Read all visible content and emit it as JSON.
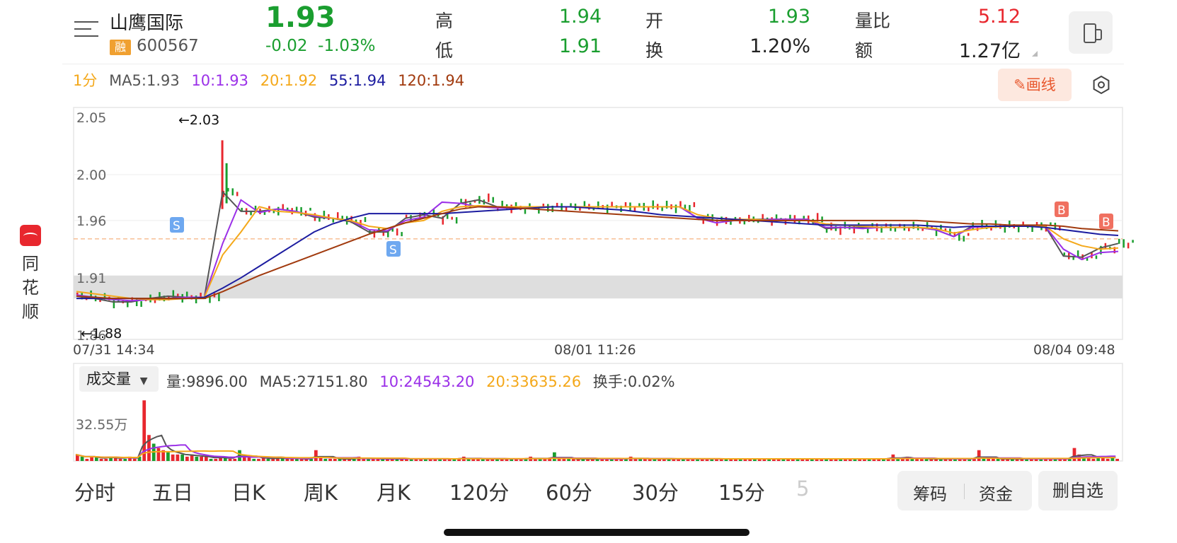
{
  "brand": {
    "name_chars": [
      "同",
      "花",
      "顺"
    ]
  },
  "header": {
    "stock_name": "山鹰国际",
    "rong_badge": "融",
    "stock_code": "600567",
    "price": "1.93",
    "change": "-0.02",
    "change_pct": "-1.03%",
    "quotes": [
      {
        "label": "高",
        "value": "1.94",
        "color": "#1a9e2f"
      },
      {
        "label": "低",
        "value": "1.91",
        "color": "#1a9e2f"
      },
      {
        "label": "开",
        "value": "1.93",
        "color": "#1a9e2f"
      },
      {
        "label": "换",
        "value": "1.20%",
        "color": "#222222"
      },
      {
        "label": "量比",
        "value": "5.12",
        "color": "#e8272e"
      },
      {
        "label": "额",
        "value": "1.27亿",
        "color": "#222222"
      }
    ]
  },
  "ma_legend": {
    "period": "1分",
    "ma5": "MA5:1.93",
    "ma10": "10:1.93",
    "ma20": "20:1.92",
    "ma55": "55:1.94",
    "ma120": "120:1.94"
  },
  "draw_button": {
    "label": "画线"
  },
  "colors": {
    "up": "#e8272e",
    "down": "#1a9e2f",
    "ma5": "#555555",
    "ma10": "#9b30e8",
    "ma20": "#f4a81a",
    "ma55": "#1c1ca0",
    "ma120": "#a13a0e"
  },
  "chart_data": {
    "type": "line",
    "title": "",
    "y_ticks": [
      "2.05",
      "2.00",
      "1.96",
      "1.91",
      "1.86"
    ],
    "ylim": [
      1.86,
      2.05
    ],
    "x_labels": [
      "07/31 14:34",
      "08/01 11:26",
      "08/04 09:48"
    ],
    "annotations": {
      "high": "←2.03",
      "low": "←1.88",
      "signals": [
        "S",
        "S",
        "B",
        "B"
      ]
    },
    "series": [
      {
        "name": "MA5",
        "color": "#555555",
        "values": [
          1.894,
          1.892,
          1.889,
          1.889,
          1.892,
          1.894,
          1.893,
          1.893,
          1.985,
          1.968,
          1.968,
          1.97,
          1.968,
          1.963,
          1.962,
          1.959,
          1.95,
          1.95,
          1.962,
          1.965,
          1.962,
          1.975,
          1.978,
          1.972,
          1.971,
          1.971,
          1.972,
          1.972,
          1.972,
          1.972,
          1.972,
          1.972,
          1.972,
          1.972,
          1.962,
          1.96,
          1.96,
          1.961,
          1.961,
          1.961,
          1.961,
          1.953,
          1.954,
          1.954,
          1.954,
          1.954,
          1.954,
          1.952,
          1.946,
          1.955,
          1.955,
          1.955,
          1.955,
          1.955,
          1.929,
          1.928,
          1.936,
          1.94
        ]
      },
      {
        "name": "10",
        "color": "#9b30e8",
        "values": [
          1.895,
          1.893,
          1.891,
          1.89,
          1.891,
          1.892,
          1.893,
          1.893,
          1.94,
          1.978,
          1.967,
          1.97,
          1.968,
          1.964,
          1.962,
          1.96,
          1.952,
          1.951,
          1.96,
          1.963,
          1.976,
          1.975,
          1.972,
          1.971,
          1.971,
          1.972,
          1.972,
          1.972,
          1.972,
          1.972,
          1.972,
          1.972,
          1.972,
          1.972,
          1.962,
          1.958,
          1.96,
          1.96,
          1.961,
          1.961,
          1.961,
          1.954,
          1.954,
          1.953,
          1.954,
          1.954,
          1.954,
          1.952,
          1.946,
          1.954,
          1.955,
          1.955,
          1.955,
          1.955,
          1.935,
          1.926,
          1.932,
          1.933
        ]
      },
      {
        "name": "20",
        "color": "#f4a81a",
        "values": [
          1.898,
          1.896,
          1.894,
          1.892,
          1.891,
          1.891,
          1.892,
          1.893,
          1.93,
          1.95,
          1.972,
          1.968,
          1.967,
          1.965,
          1.962,
          1.96,
          1.955,
          1.953,
          1.958,
          1.96,
          1.968,
          1.972,
          1.973,
          1.972,
          1.972,
          1.972,
          1.972,
          1.972,
          1.972,
          1.972,
          1.972,
          1.972,
          1.972,
          1.972,
          1.965,
          1.962,
          1.961,
          1.961,
          1.96,
          1.96,
          1.96,
          1.957,
          1.956,
          1.955,
          1.954,
          1.954,
          1.954,
          1.953,
          1.949,
          1.952,
          1.954,
          1.955,
          1.955,
          1.955,
          1.944,
          1.938,
          1.935,
          1.936
        ]
      },
      {
        "name": "55",
        "color": "#1c1ca0",
        "values": [
          1.892,
          1.892,
          1.892,
          1.892,
          1.892,
          1.892,
          1.892,
          1.893,
          1.901,
          1.91,
          1.92,
          1.93,
          1.94,
          1.95,
          1.957,
          1.962,
          1.966,
          1.966,
          1.966,
          1.966,
          1.966,
          1.967,
          1.968,
          1.969,
          1.97,
          1.971,
          1.972,
          1.972,
          1.971,
          1.97,
          1.969,
          1.967,
          1.965,
          1.964,
          1.963,
          1.962,
          1.961,
          1.96,
          1.959,
          1.958,
          1.957,
          1.956,
          1.956,
          1.956,
          1.956,
          1.956,
          1.956,
          1.955,
          1.954,
          1.955,
          1.955,
          1.955,
          1.955,
          1.954,
          1.952,
          1.95,
          1.948,
          1.947
        ]
      },
      {
        "name": "120",
        "color": "#a13a0e",
        "values": [
          1.894,
          1.893,
          1.892,
          1.892,
          1.892,
          1.892,
          1.892,
          1.892,
          1.898,
          1.905,
          1.912,
          1.918,
          1.924,
          1.93,
          1.936,
          1.942,
          1.948,
          1.953,
          1.958,
          1.962,
          1.966,
          1.97,
          1.972,
          1.972,
          1.971,
          1.97,
          1.969,
          1.968,
          1.967,
          1.966,
          1.965,
          1.964,
          1.963,
          1.962,
          1.961,
          1.96,
          1.96,
          1.96,
          1.96,
          1.96,
          1.96,
          1.96,
          1.96,
          1.96,
          1.96,
          1.96,
          1.96,
          1.959,
          1.958,
          1.957,
          1.957,
          1.956,
          1.956,
          1.956,
          1.955,
          1.953,
          1.952,
          1.951
        ]
      }
    ],
    "volume": {
      "y_tick": "32.55万",
      "values": [
        3,
        2,
        1,
        2,
        2,
        1,
        1,
        2,
        2,
        1,
        1,
        2,
        1,
        2,
        28,
        12,
        8,
        6,
        5,
        4,
        3,
        3,
        3,
        2,
        3,
        2,
        2,
        2,
        1,
        1,
        2,
        2,
        1,
        1,
        5,
        2,
        2,
        1,
        1,
        2,
        1,
        1,
        1,
        2,
        1,
        1,
        1,
        1,
        1,
        1,
        5,
        2,
        1,
        1,
        1,
        1,
        1,
        1,
        1,
        2,
        1,
        1,
        1,
        1,
        1,
        1,
        1,
        1,
        1,
        1,
        1,
        1,
        1,
        1,
        1,
        1,
        1,
        1,
        1,
        1,
        1,
        2,
        1,
        1,
        1,
        1,
        1,
        1,
        1,
        1,
        1,
        1,
        1,
        1,
        1,
        2,
        1,
        1,
        1,
        1,
        4,
        1,
        1,
        1,
        1,
        1,
        1,
        1,
        1,
        1,
        1,
        1,
        1,
        1,
        1,
        1,
        2,
        1,
        1,
        1,
        1,
        1,
        1,
        1,
        1,
        1,
        1,
        1,
        1,
        1,
        1,
        1,
        1,
        1,
        1,
        1,
        1,
        1,
        1,
        1,
        1,
        1,
        1,
        1,
        1,
        1,
        1,
        1,
        1,
        1,
        1,
        1,
        1,
        1,
        1,
        1,
        1,
        1,
        1,
        1,
        1,
        1,
        1,
        1,
        1,
        1,
        1,
        1,
        1,
        1,
        1,
        3,
        1,
        1,
        2,
        1,
        1,
        1,
        1,
        1,
        1,
        1,
        1,
        1,
        1,
        1,
        1,
        1,
        1,
        5,
        1,
        1,
        1,
        1,
        1,
        1,
        1,
        1,
        1,
        1,
        1,
        1,
        1,
        1,
        1,
        1,
        1,
        1,
        1,
        6,
        3,
        2,
        2,
        1,
        2,
        2,
        1,
        2,
        1
      ]
    }
  },
  "volume_panel": {
    "selector": "成交量",
    "vol": "量:9896.00",
    "ma5": "MA5:27151.80",
    "ma10": "10:24543.20",
    "ma20": "20:33635.26",
    "turnover": "换手:0.02%"
  },
  "tabs": [
    "分时",
    "五日",
    "日K",
    "周K",
    "月K",
    "120分",
    "60分",
    "30分",
    "15分",
    "5"
  ],
  "buttons": {
    "chips": "筹码",
    "funds": "资金",
    "delete_fav": "删自选"
  }
}
